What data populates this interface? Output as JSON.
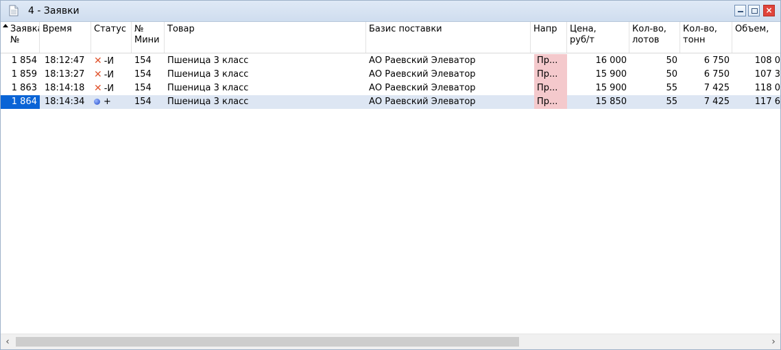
{
  "window": {
    "title": "4 - Заявки",
    "close_label": "×"
  },
  "columns": [
    "Заявка\n№",
    "Время",
    "Статус",
    "№\nМини",
    "Товар",
    "Базис поставки",
    "Напр",
    "Цена,\nруб/т",
    "Кол-во,\nлотов",
    "Кол-во,\nтонн",
    "Объем,"
  ],
  "rows": [
    {
      "num": "1 854",
      "time": "18:12:47",
      "status_icon": "x-icon",
      "status_mark": "✕",
      "status_text": "-И",
      "mini": "154",
      "product": "Пшеница 3 класс",
      "basis": "АО Раевский Элеватор",
      "dir": "Пр...",
      "price": "16 000",
      "lots": "50",
      "tons": "6 750",
      "volume": "108 0"
    },
    {
      "num": "1 859",
      "time": "18:13:27",
      "status_icon": "x-icon",
      "status_mark": "✕",
      "status_text": "-И",
      "mini": "154",
      "product": "Пшеница 3 класс",
      "basis": "АО Раевский Элеватор",
      "dir": "Пр...",
      "price": "15 900",
      "lots": "50",
      "tons": "6 750",
      "volume": "107 3"
    },
    {
      "num": "1 863",
      "time": "18:14:18",
      "status_icon": "x-icon",
      "status_mark": "✕",
      "status_text": "-И",
      "mini": "154",
      "product": "Пшеница 3 класс",
      "basis": "АО Раевский Элеватор",
      "dir": "Пр...",
      "price": "15 900",
      "lots": "55",
      "tons": "7 425",
      "volume": "118 0"
    },
    {
      "num": "1 864",
      "time": "18:14:34",
      "status_icon": "blue-dot-icon",
      "status_mark": "",
      "status_text": "+",
      "mini": "154",
      "product": "Пшеница 3 класс",
      "basis": "АО Раевский Элеватор",
      "dir": "Пр...",
      "price": "15 850",
      "lots": "55",
      "tons": "7 425",
      "volume": "117 6"
    }
  ],
  "scrollbar": {
    "left_arrow": "‹",
    "right_arrow": "›"
  },
  "colors": {
    "selected_cell": "#0a64d6",
    "selected_row": "#dde6f3",
    "direction_cell": "#f4c9cc",
    "cancel_mark": "#e0522b"
  }
}
